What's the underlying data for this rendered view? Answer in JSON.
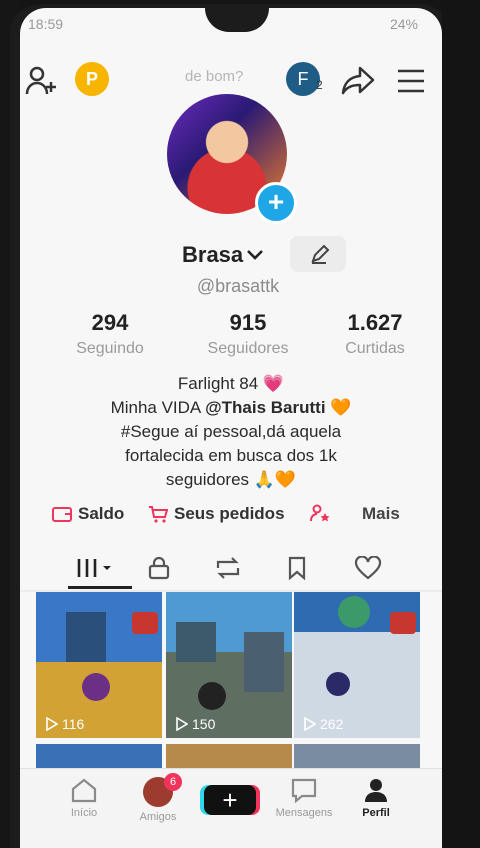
{
  "status": {
    "time": "18:59",
    "battery": "24%"
  },
  "topbar": {
    "premium_letter": "P",
    "title": "de bom?",
    "friend_letter": "F",
    "friend_count": "2"
  },
  "profile": {
    "name": "Brasa",
    "handle": "@brasattk"
  },
  "stats": [
    {
      "value": "294",
      "label": "Seguindo"
    },
    {
      "value": "915",
      "label": "Seguidores"
    },
    {
      "value": "1.627",
      "label": "Curtidas"
    }
  ],
  "bio": {
    "line1": "Farlight 84 💗",
    "line2_prefix": "Minha VIDA ",
    "line2_mention": "@Thais Barutti",
    "line2_suffix": " 🧡",
    "line3": "#Segue aí pessoal,dá aquela",
    "line4": "fortalecida  em busca dos 1k",
    "line5": "seguidores 🙏🧡"
  },
  "shop": {
    "balance": "Saldo",
    "orders": "Seus pedidos",
    "more": "Mais"
  },
  "videos": [
    {
      "views": "116"
    },
    {
      "views": "150"
    },
    {
      "views": "262"
    }
  ],
  "nav": {
    "home": "Início",
    "friends": "Amigos",
    "friends_badge": "6",
    "create": "+",
    "messages": "Mensagens",
    "profile": "Perfil"
  },
  "colors": {
    "accent_red": "#f0345c",
    "accent_cyan": "#2fd7e6",
    "add_blue": "#1fa6e6"
  }
}
